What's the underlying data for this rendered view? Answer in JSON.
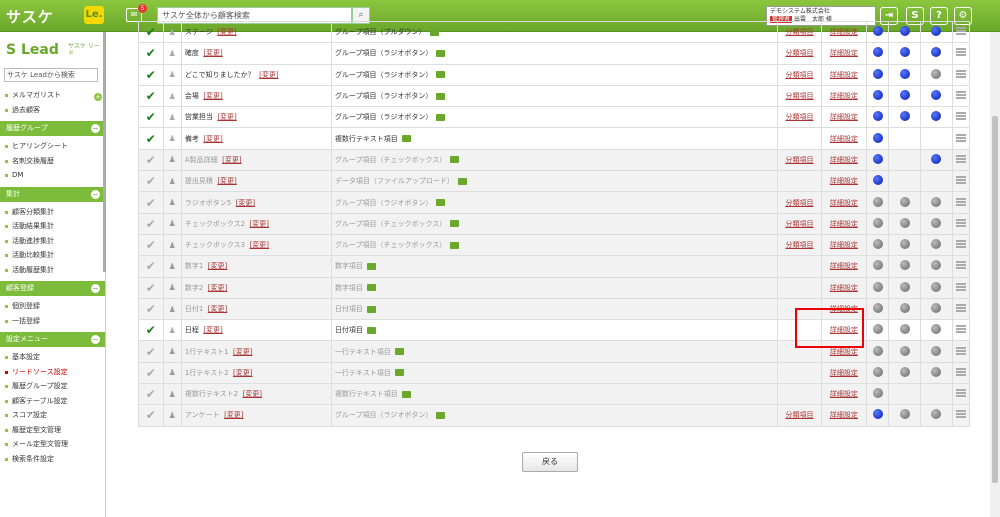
{
  "header": {
    "logo": "サスケ",
    "logo_le": "Le.",
    "mail_badge": "5",
    "search_placeholder": "サスケ全体から顧客検索",
    "company": "デモシステム株式会社",
    "role": "管理者",
    "user": "出雲　太郎 様",
    "logout": "Logout",
    "help": "?"
  },
  "sidebar": {
    "lead_logo": "Lead",
    "lead_small": "サスケ リード",
    "search_placeholder": "サスケ Leadから検索",
    "top_items": [
      "メルマガリスト",
      "過去顧客"
    ],
    "groups": [
      {
        "title": "履歴グループ",
        "items": [
          "ヒアリングシート",
          "名刺交換履歴",
          "DM"
        ]
      },
      {
        "title": "集計",
        "items": [
          "顧客分類集計",
          "活動結果集計",
          "活動進捗集計",
          "活動比較集計",
          "活動履歴集計"
        ]
      },
      {
        "title": "顧客登録",
        "items": [
          "個別登録",
          "一括登録"
        ]
      },
      {
        "title": "設定メニュー",
        "items": [
          "基本設定",
          "リードソース設定",
          "履歴グループ設定",
          "顧客テーブル設定",
          "スコア設定",
          "履歴定型文管理",
          "メール定型文管理",
          "検索条件設定"
        ]
      }
    ]
  },
  "table": {
    "change_label": "[変更]",
    "category_label": "分類項目",
    "detail_label": "詳細設定",
    "rows": [
      {
        "checked": true,
        "name": "ステージ",
        "type": "グループ項目（プルダウン）",
        "category": true,
        "dots": [
          "blue",
          "blue",
          "blue"
        ],
        "dim": false
      },
      {
        "checked": true,
        "name": "確度",
        "type": "グループ項目（ラジオボタン）",
        "category": true,
        "dots": [
          "blue",
          "blue",
          "blue"
        ],
        "dim": false
      },
      {
        "checked": true,
        "name": "どこで知りましたか？",
        "type": "グループ項目（ラジオボタン）",
        "category": true,
        "dots": [
          "blue",
          "blue",
          "gray"
        ],
        "dim": false
      },
      {
        "checked": true,
        "name": "会場",
        "type": "グループ項目（ラジオボタン）",
        "category": true,
        "dots": [
          "blue",
          "blue",
          "blue"
        ],
        "dim": false
      },
      {
        "checked": true,
        "name": "営業担当",
        "type": "グループ項目（ラジオボタン）",
        "category": true,
        "dots": [
          "blue",
          "blue",
          "blue"
        ],
        "dim": false
      },
      {
        "checked": true,
        "name": "備考",
        "type": "複数行テキスト項目",
        "category": false,
        "dots": [
          "blue",
          "",
          ""
        ],
        "dim": false
      },
      {
        "checked": false,
        "name": "A製品詳細",
        "type": "グループ項目（チェックボックス）",
        "category": true,
        "dots": [
          "blue",
          "",
          "blue"
        ],
        "dim": true
      },
      {
        "checked": false,
        "name": "提出見積",
        "type": "データ項目（ファイルアップロード）",
        "category": false,
        "dots": [
          "blue",
          "",
          ""
        ],
        "dim": true
      },
      {
        "checked": false,
        "name": "ラジオボタン5",
        "type": "グループ項目（ラジオボタン）",
        "category": true,
        "dots": [
          "gray",
          "gray",
          "gray"
        ],
        "dim": true
      },
      {
        "checked": false,
        "name": "チェックボックス2",
        "type": "グループ項目（チェックボックス）",
        "category": true,
        "dots": [
          "gray",
          "gray",
          "gray"
        ],
        "dim": true
      },
      {
        "checked": false,
        "name": "チェックボックス3",
        "type": "グループ項目（チェックボックス）",
        "category": true,
        "dots": [
          "gray",
          "gray",
          "gray"
        ],
        "dim": true
      },
      {
        "checked": false,
        "name": "数字1",
        "type": "数字項目",
        "category": false,
        "dots": [
          "gray",
          "gray",
          "gray"
        ],
        "dim": true
      },
      {
        "checked": false,
        "name": "数字2",
        "type": "数字項目",
        "category": false,
        "dots": [
          "gray",
          "gray",
          "gray"
        ],
        "dim": true
      },
      {
        "checked": false,
        "name": "日付1",
        "type": "日付項目",
        "category": false,
        "dots": [
          "gray",
          "gray",
          "gray"
        ],
        "dim": true
      },
      {
        "checked": true,
        "name": "日程",
        "type": "日付項目",
        "category": false,
        "dots": [
          "gray",
          "gray",
          "gray"
        ],
        "dim": false
      },
      {
        "checked": false,
        "name": "1行テキスト1",
        "type": "一行テキスト項目",
        "category": false,
        "dots": [
          "gray",
          "gray",
          "gray"
        ],
        "dim": true
      },
      {
        "checked": false,
        "name": "1行テキスト2",
        "type": "一行テキスト項目",
        "category": false,
        "dots": [
          "gray",
          "gray",
          "gray"
        ],
        "dim": true
      },
      {
        "checked": false,
        "name": "複数行テキスト2",
        "type": "複数行テキスト項目",
        "category": false,
        "dots": [
          "gray",
          "",
          ""
        ],
        "dim": true
      },
      {
        "checked": false,
        "name": "アンケート",
        "type": "グループ項目（ラジオボタン）",
        "category": true,
        "dots": [
          "blue",
          "gray",
          "gray"
        ],
        "dim": true
      }
    ]
  },
  "back_button": "戻る",
  "colors": {
    "brand": "#7dbb3a",
    "highlight": "#e00000"
  }
}
